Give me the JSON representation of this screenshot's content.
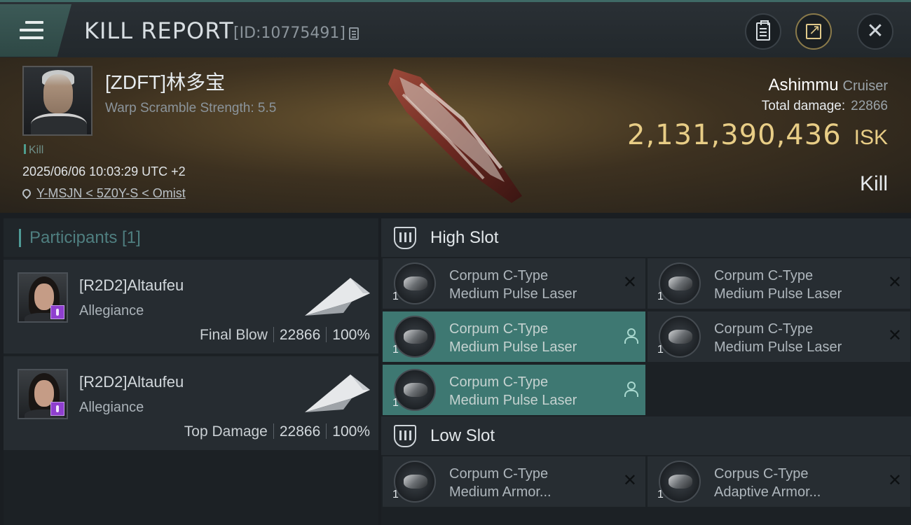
{
  "header": {
    "title": "KILL REPORT",
    "report_id": "[ID:10775491]"
  },
  "victim": {
    "pilot_name": "[ZDFT]林多宝",
    "warp_scramble": "Warp Scramble Strength: 5.5",
    "kill_tag": "Kill",
    "datetime": "2025/06/06 10:03:29 UTC +2",
    "location": "Y-MSJN < 5Z0Y-S < Omist",
    "ship_name": "Ashimmu",
    "ship_class": "Cruiser",
    "total_damage_label": "Total damage:",
    "total_damage": "22866",
    "isk_value": "2,131,390,436",
    "isk_unit": "ISK",
    "result": "Kill"
  },
  "participants": {
    "label": "Participants [1]",
    "items": [
      {
        "name": "[R2D2]Altaufeu",
        "corp": "Allegiance",
        "role": "Final Blow",
        "damage": "22866",
        "percent": "100%"
      },
      {
        "name": "[R2D2]Altaufeu",
        "corp": "Allegiance",
        "role": "Top Damage",
        "damage": "22866",
        "percent": "100%"
      }
    ]
  },
  "fitting": {
    "high_slot_label": "High Slot",
    "low_slot_label": "Low Slot",
    "high": [
      {
        "qty": "1",
        "line1": "Corpum C-Type",
        "line2": "Medium Pulse Laser",
        "state": "destroyed"
      },
      {
        "qty": "1",
        "line1": "Corpum C-Type",
        "line2": "Medium Pulse Laser",
        "state": "destroyed"
      },
      {
        "qty": "1",
        "line1": "Corpum C-Type",
        "line2": "Medium Pulse Laser",
        "state": "dropped"
      },
      {
        "qty": "1",
        "line1": "Corpum C-Type",
        "line2": "Medium Pulse Laser",
        "state": "destroyed"
      },
      {
        "qty": "1",
        "line1": "Corpum C-Type",
        "line2": "Medium Pulse Laser",
        "state": "dropped"
      }
    ],
    "low": [
      {
        "qty": "1",
        "line1": "Corpum C-Type",
        "line2": "Medium Armor...",
        "state": "destroyed"
      },
      {
        "qty": "1",
        "line1": "Corpus C-Type",
        "line2": "Adaptive Armor...",
        "state": "destroyed"
      }
    ]
  },
  "icons": {
    "menu": "menu-icon",
    "copy": "copy-icon",
    "clipboard": "clipboard-icon",
    "share": "share-icon",
    "close": "close-icon",
    "location": "location-pin-icon",
    "slot": "slot-icon",
    "destroyed": "x-icon",
    "dropped": "person-icon"
  },
  "colors": {
    "accent_teal": "#3e7872",
    "isk_gold": "#e8cd86",
    "panel_dark": "#1c2125"
  }
}
